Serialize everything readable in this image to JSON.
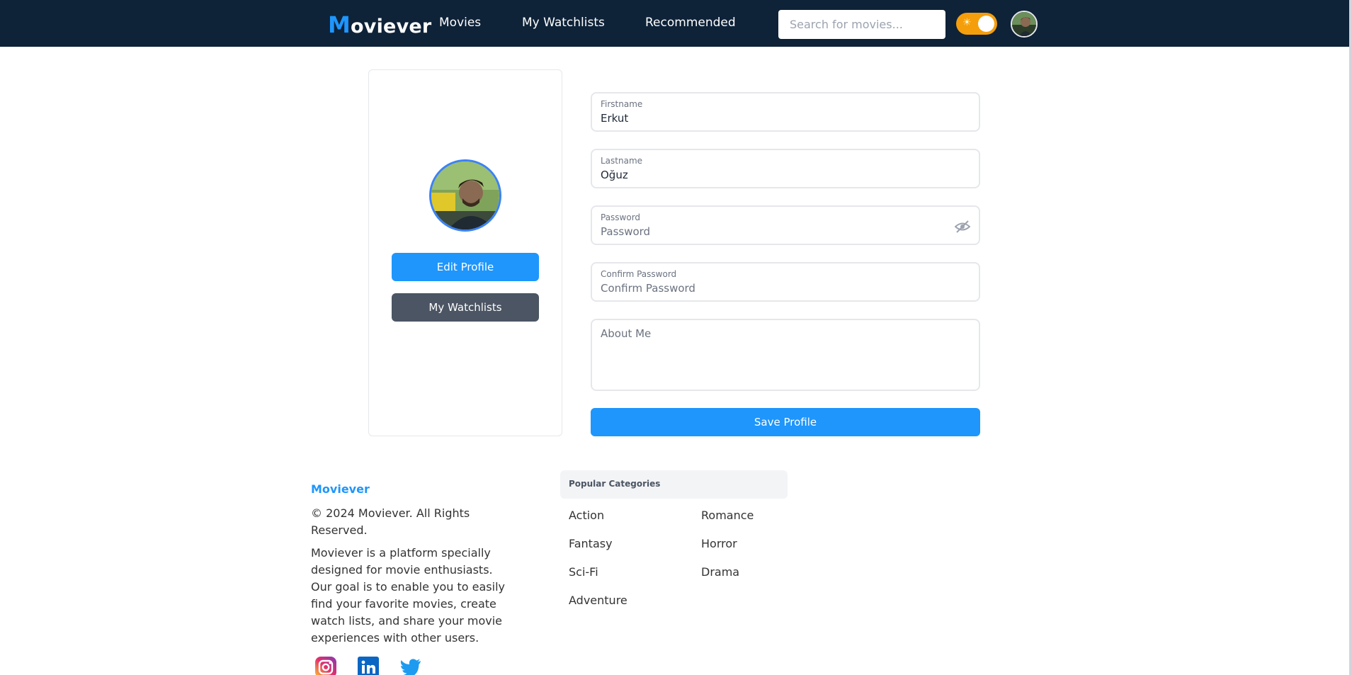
{
  "header": {
    "logo_first": "M",
    "logo_rest": "oviever",
    "nav": [
      "Movies",
      "My Watchlists",
      "Recommended"
    ],
    "search_placeholder": "Search for movies...",
    "theme_toggle_icon": "sun-icon"
  },
  "profile_card": {
    "edit_label": "Edit Profile",
    "watchlists_label": "My Watchlists"
  },
  "form": {
    "firstname_label": "Firstname",
    "firstname_value": "Erkut",
    "lastname_label": "Lastname",
    "lastname_value": "Oğuz",
    "password_label": "Password",
    "password_placeholder": "Password",
    "confirm_label": "Confirm Password",
    "confirm_placeholder": "Confirm Password",
    "about_placeholder": "About Me",
    "save_label": "Save Profile"
  },
  "footer": {
    "brand": "Moviever",
    "copyright": "© 2024 Moviever. All Rights Reserved.",
    "description": "Moviever is a platform specially designed for movie enthusiasts. Our goal is to enable you to easily find your favorite movies, create watch lists, and share your movie experiences with other users.",
    "categories_title": "Popular Categories",
    "categories": [
      "Action",
      "Romance",
      "Fantasy",
      "Horror",
      "Sci-Fi",
      "Drama",
      "Adventure"
    ],
    "social": [
      "instagram-icon",
      "linkedin-icon",
      "twitter-icon"
    ]
  },
  "colors": {
    "header_bg": "#0e2238",
    "accent": "#1e96fc",
    "secondary_button": "#4b5563",
    "toggle": "#f59e0b"
  }
}
